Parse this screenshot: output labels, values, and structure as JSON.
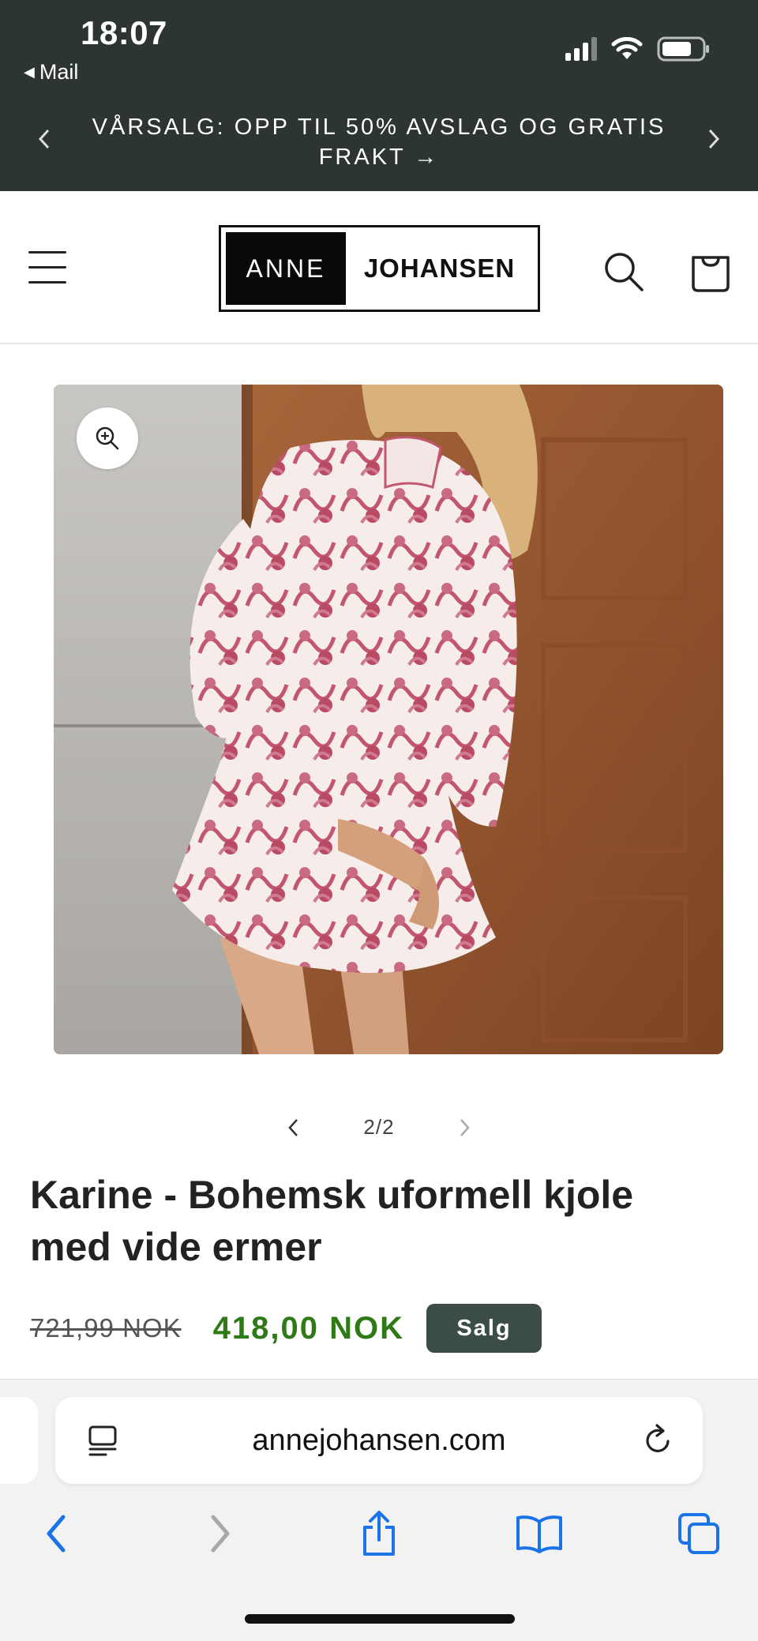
{
  "status_bar": {
    "time": "18:07",
    "back_app": "Mail",
    "back_icon": "back-triangle-icon"
  },
  "announcement": {
    "text": "VÅRSALG: OPP TIL 50% AVSLAG OG GRATIS FRAKT →"
  },
  "header": {
    "logo_left": "ANNE",
    "logo_right": "JOHANSEN"
  },
  "gallery": {
    "counter": "2/2"
  },
  "product": {
    "title": "Karine - Bohemsk uformell kjole med vide ermer",
    "price_original": "721,99 NOK",
    "price_sale": "418,00 NOK",
    "badge": "Salg"
  },
  "browser": {
    "url": "annejohansen.com"
  },
  "colors": {
    "top_bar": "#2c3531",
    "sale_price": "#2f7a16",
    "badge_bg": "#3b4d44",
    "ios_blue": "#1a73e8"
  }
}
